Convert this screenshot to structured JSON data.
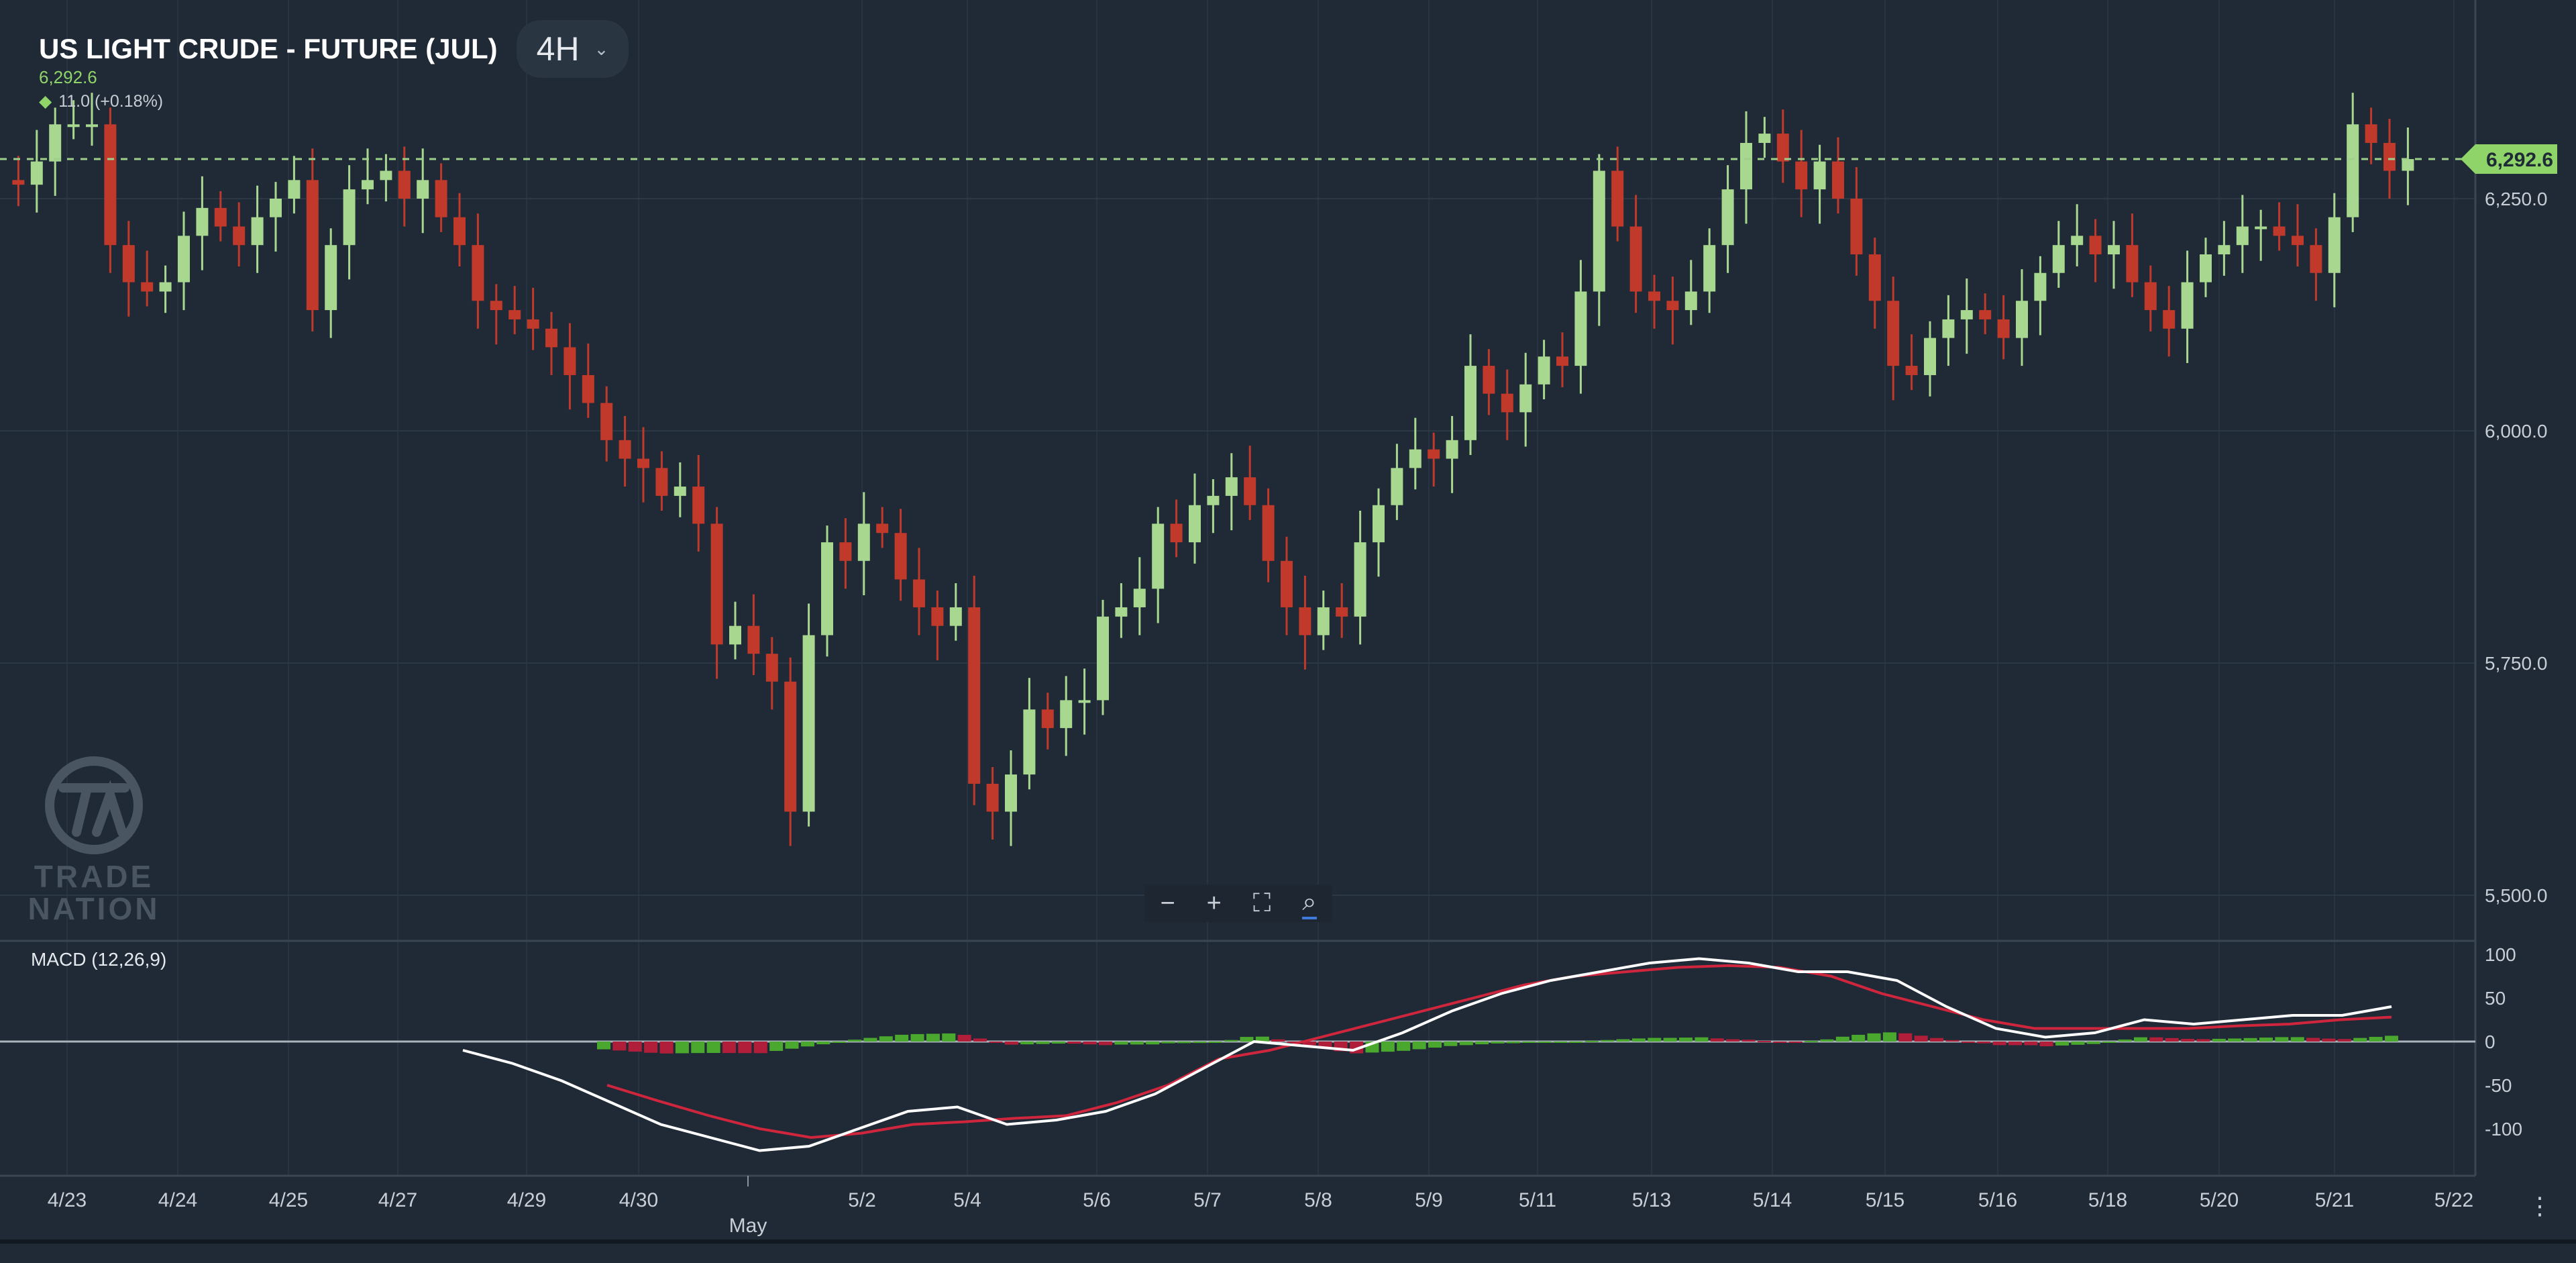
{
  "header": {
    "instrument": "US LIGHT CRUDE - FUTURE (JUL)",
    "timeframe": "4H",
    "last_price": "6,292.6",
    "change": "11.0 (+0.18%)"
  },
  "price_tag": "6,292.6",
  "macd_label": "MACD (12,26,9)",
  "watermark": {
    "line1": "TRADE",
    "line2": "NATION"
  },
  "zoom_controls": [
    "zoom-out",
    "zoom-in",
    "fit-screen",
    "zoom-reset"
  ],
  "colors": {
    "up": "#a8d890",
    "down": "#c0392b",
    "macd_line": "#ffffff",
    "signal_line": "#d0263d",
    "hist_up": "#4ba82e",
    "hist_down": "#b01e3a",
    "background": "#1f2a36",
    "last_price": "#8fd469"
  },
  "chart_data": {
    "type": "candlestick",
    "price_axis": {
      "ticks": [
        5500,
        5750,
        6000,
        6250
      ],
      "tick_labels": [
        "5,500.0",
        "5,750.0",
        "6,000.0",
        "6,250.0"
      ],
      "last": 6292.6
    },
    "x_tick_labels": [
      "4/23",
      "4/24",
      "4/25",
      "4/27",
      "4/29",
      "4/30",
      "May",
      "5/2",
      "5/4",
      "5/6",
      "5/7",
      "5/8",
      "5/9",
      "5/11",
      "5/13",
      "5/14",
      "5/15",
      "5/16",
      "5/18",
      "5/20",
      "5/21",
      "5/22"
    ],
    "closes": [
      6270,
      6265,
      6290,
      6330,
      6330,
      6330,
      6200,
      6160,
      6150,
      6160,
      6210,
      6240,
      6220,
      6200,
      6230,
      6250,
      6270,
      6130,
      6200,
      6260,
      6270,
      6280,
      6250,
      6270,
      6230,
      6200,
      6140,
      6130,
      6120,
      6110,
      6090,
      6060,
      6030,
      5990,
      5970,
      5960,
      5930,
      5940,
      5900,
      5770,
      5790,
      5760,
      5730,
      5590,
      5780,
      5880,
      5860,
      5900,
      5890,
      5840,
      5810,
      5790,
      5810,
      5620,
      5590,
      5630,
      5700,
      5680,
      5710,
      5710,
      5800,
      5810,
      5830,
      5900,
      5880,
      5920,
      5930,
      5950,
      5920,
      5860,
      5810,
      5780,
      5810,
      5800,
      5880,
      5920,
      5960,
      5980,
      5970,
      5990,
      6070,
      6040,
      6020,
      6050,
      6080,
      6070,
      6150,
      6280,
      6220,
      6150,
      6140,
      6130,
      6150,
      6200,
      6260,
      6310,
      6320,
      6290,
      6260,
      6290,
      6250,
      6190,
      6140,
      6070,
      6060,
      6100,
      6120,
      6130,
      6120,
      6100,
      6140,
      6170,
      6200,
      6210,
      6190,
      6200,
      6160,
      6130,
      6110,
      6160,
      6190,
      6200,
      6220,
      6220,
      6210,
      6200,
      6170,
      6230,
      6330,
      6310,
      6280,
      6292.6
    ],
    "macd": {
      "params": "12,26,9",
      "axis_ticks": [
        100,
        50,
        0,
        -50,
        -100
      ],
      "macd_line": [
        -10,
        -25,
        -45,
        -70,
        -95,
        -110,
        -125,
        -120,
        -100,
        -80,
        -75,
        -95,
        -90,
        -80,
        -60,
        -30,
        0,
        -5,
        -10,
        10,
        35,
        55,
        70,
        80,
        90,
        95,
        90,
        80,
        80,
        70,
        40,
        15,
        5,
        10,
        25,
        20,
        25,
        30,
        30,
        40
      ],
      "signal_line": [
        -50,
        -68,
        -85,
        -100,
        -110,
        -105,
        -95,
        -92,
        -88,
        -85,
        -70,
        -50,
        -20,
        -10,
        5,
        20,
        35,
        50,
        65,
        75,
        80,
        85,
        87,
        85,
        75,
        55,
        40,
        25,
        15,
        15,
        15,
        15,
        18,
        20,
        25,
        28
      ]
    }
  }
}
